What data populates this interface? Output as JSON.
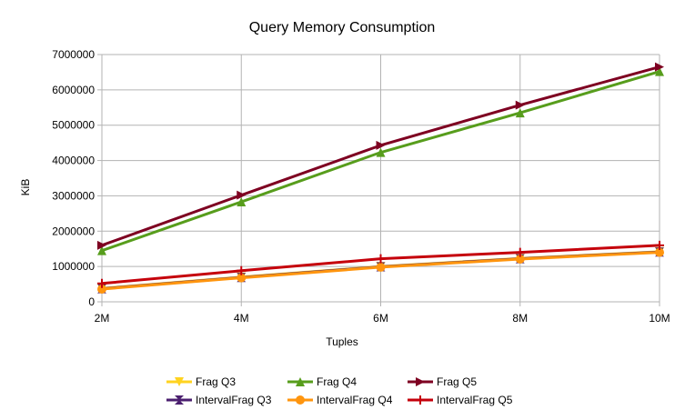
{
  "chart_data": {
    "type": "line",
    "title": "Query Memory Consumption",
    "xlabel": "Tuples",
    "ylabel": "KiB",
    "categories": [
      "2M",
      "4M",
      "6M",
      "8M",
      "10M"
    ],
    "ylim": [
      0,
      7000000
    ],
    "yticks": [
      "0",
      "1000000",
      "2000000",
      "3000000",
      "4000000",
      "5000000",
      "6000000",
      "7000000"
    ],
    "grid": true,
    "legend": "bottom",
    "series": [
      {
        "name": "Frag Q3",
        "color": "#ffd320",
        "marker": "triangle-down",
        "values": [
          380000,
          700000,
          1000000,
          1230000,
          1420000
        ]
      },
      {
        "name": "Frag Q4",
        "color": "#579d1c",
        "marker": "triangle-up",
        "values": [
          1450000,
          2830000,
          4230000,
          5350000,
          6520000
        ]
      },
      {
        "name": "Frag Q5",
        "color": "#7e0021",
        "marker": "triangle-right",
        "values": [
          1600000,
          3020000,
          4430000,
          5570000,
          6650000
        ]
      },
      {
        "name": "IntervalFrag Q3",
        "color": "#4b1f6f",
        "marker": "hourglass",
        "values": [
          370000,
          690000,
          990000,
          1220000,
          1410000
        ]
      },
      {
        "name": "IntervalFrag Q4",
        "color": "#ff950e",
        "marker": "circle",
        "values": [
          360000,
          680000,
          980000,
          1210000,
          1400000
        ]
      },
      {
        "name": "IntervalFrag Q5",
        "color": "#c5000b",
        "marker": "plus",
        "values": [
          520000,
          880000,
          1220000,
          1400000,
          1600000
        ]
      }
    ]
  }
}
